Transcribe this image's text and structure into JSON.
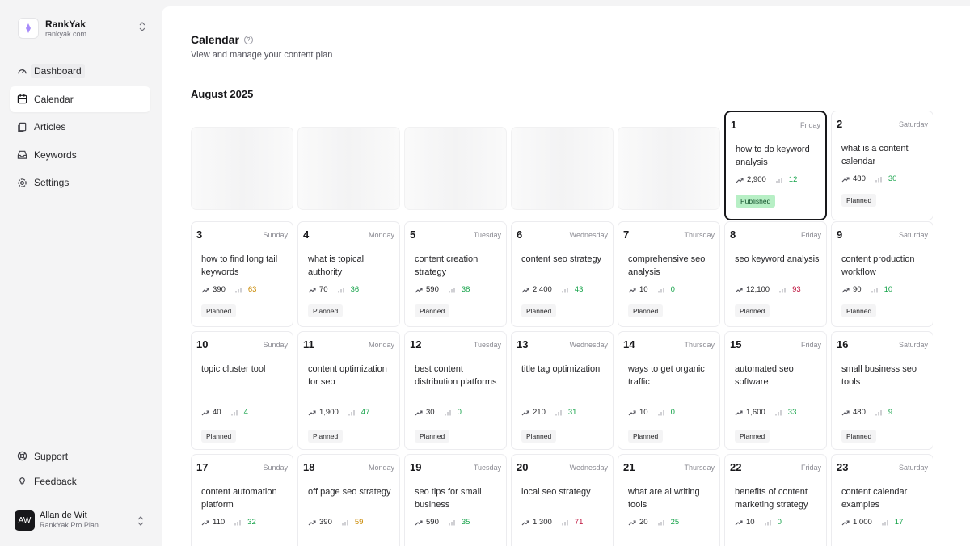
{
  "brand": {
    "name": "RankYak",
    "domain": "rankyak.com"
  },
  "nav": {
    "dashboard": "Dashboard",
    "calendar": "Calendar",
    "articles": "Articles",
    "keywords": "Keywords",
    "settings": "Settings",
    "support": "Support",
    "feedback": "Feedback"
  },
  "user": {
    "initials": "AW",
    "name": "Allan de Wit",
    "plan": "RankYak Pro Plan"
  },
  "page": {
    "title": "Calendar",
    "subtitle": "View and manage your content plan",
    "month": "August 2025"
  },
  "colors": {
    "green": "#16a34a",
    "yellow": "#ca8a04",
    "red": "#be123c"
  },
  "days": [
    {
      "num": "1",
      "name": "Friday",
      "keyword": "how to do keyword analysis",
      "volume": "2,900",
      "difficulty": "12",
      "diff_color": "green",
      "status": "Published"
    },
    {
      "num": "2",
      "name": "Saturday",
      "keyword": "what is a content calendar",
      "volume": "480",
      "difficulty": "30",
      "diff_color": "green",
      "status": "Planned"
    },
    {
      "num": "3",
      "name": "Sunday",
      "keyword": "how to find long tail keywords",
      "volume": "390",
      "difficulty": "63",
      "diff_color": "yellow",
      "status": "Planned"
    },
    {
      "num": "4",
      "name": "Monday",
      "keyword": "what is topical authority",
      "volume": "70",
      "difficulty": "36",
      "diff_color": "green",
      "status": "Planned"
    },
    {
      "num": "5",
      "name": "Tuesday",
      "keyword": "content creation strategy",
      "volume": "590",
      "difficulty": "38",
      "diff_color": "green",
      "status": "Planned"
    },
    {
      "num": "6",
      "name": "Wednesday",
      "keyword": "content seo strategy",
      "volume": "2,400",
      "difficulty": "43",
      "diff_color": "green",
      "status": "Planned"
    },
    {
      "num": "7",
      "name": "Thursday",
      "keyword": "comprehensive seo analysis",
      "volume": "10",
      "difficulty": "0",
      "diff_color": "green",
      "status": "Planned"
    },
    {
      "num": "8",
      "name": "Friday",
      "keyword": "seo keyword analysis",
      "volume": "12,100",
      "difficulty": "93",
      "diff_color": "red",
      "status": "Planned"
    },
    {
      "num": "9",
      "name": "Saturday",
      "keyword": "content production workflow",
      "volume": "90",
      "difficulty": "10",
      "diff_color": "green",
      "status": "Planned"
    },
    {
      "num": "10",
      "name": "Sunday",
      "keyword": "topic cluster tool",
      "volume": "40",
      "difficulty": "4",
      "diff_color": "green",
      "status": "Planned"
    },
    {
      "num": "11",
      "name": "Monday",
      "keyword": "content optimization for seo",
      "volume": "1,900",
      "difficulty": "47",
      "diff_color": "green",
      "status": "Planned"
    },
    {
      "num": "12",
      "name": "Tuesday",
      "keyword": "best content distribution platforms",
      "volume": "30",
      "difficulty": "0",
      "diff_color": "green",
      "status": "Planned"
    },
    {
      "num": "13",
      "name": "Wednesday",
      "keyword": "title tag optimization",
      "volume": "210",
      "difficulty": "31",
      "diff_color": "green",
      "status": "Planned"
    },
    {
      "num": "14",
      "name": "Thursday",
      "keyword": "ways to get organic traffic",
      "volume": "10",
      "difficulty": "0",
      "diff_color": "green",
      "status": "Planned"
    },
    {
      "num": "15",
      "name": "Friday",
      "keyword": "automated seo software",
      "volume": "1,600",
      "difficulty": "33",
      "diff_color": "green",
      "status": "Planned"
    },
    {
      "num": "16",
      "name": "Saturday",
      "keyword": "small business seo tools",
      "volume": "480",
      "difficulty": "9",
      "diff_color": "green",
      "status": "Planned"
    },
    {
      "num": "17",
      "name": "Sunday",
      "keyword": "content automation platform",
      "volume": "110",
      "difficulty": "32",
      "diff_color": "green",
      "status": ""
    },
    {
      "num": "18",
      "name": "Monday",
      "keyword": "off page seo strategy",
      "volume": "390",
      "difficulty": "59",
      "diff_color": "yellow",
      "status": ""
    },
    {
      "num": "19",
      "name": "Tuesday",
      "keyword": "seo tips for small business",
      "volume": "590",
      "difficulty": "35",
      "diff_color": "green",
      "status": ""
    },
    {
      "num": "20",
      "name": "Wednesday",
      "keyword": "local seo strategy",
      "volume": "1,300",
      "difficulty": "71",
      "diff_color": "red",
      "status": ""
    },
    {
      "num": "21",
      "name": "Thursday",
      "keyword": "what are ai writing tools",
      "volume": "20",
      "difficulty": "25",
      "diff_color": "green",
      "status": ""
    },
    {
      "num": "22",
      "name": "Friday",
      "keyword": "benefits of content marketing strategy",
      "volume": "10",
      "difficulty": "0",
      "diff_color": "green",
      "status": ""
    },
    {
      "num": "23",
      "name": "Saturday",
      "keyword": "content calendar examples",
      "volume": "1,000",
      "difficulty": "17",
      "diff_color": "green",
      "status": ""
    }
  ]
}
